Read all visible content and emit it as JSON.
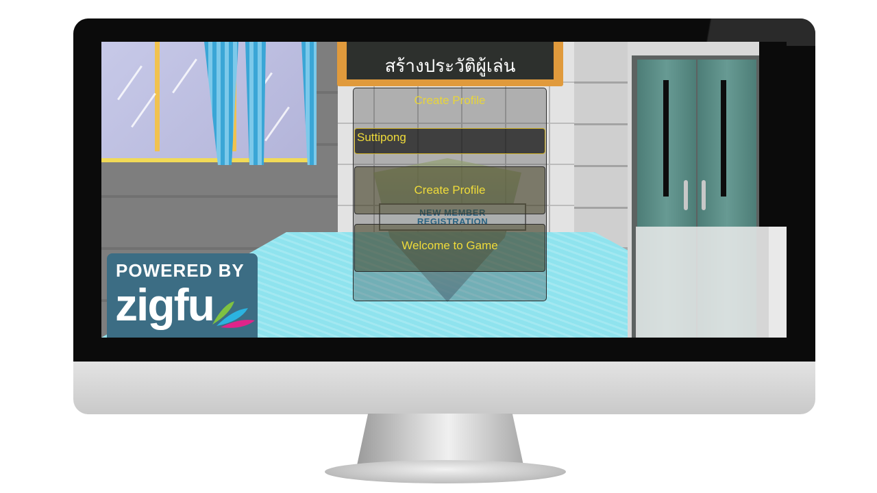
{
  "scene": {
    "chalkboard_title": "สร้างประวัติผู้เล่น",
    "emblem_lines": [
      "NEW MEMBER",
      "REGISTRATION"
    ]
  },
  "profile_panel": {
    "title": "Create Profile",
    "name_value": "Suttipong",
    "create_button_label": "Create Profile",
    "welcome_button_label": "Welcome to Game"
  },
  "badge": {
    "powered_by": "POWERED BY",
    "logo_text": "zigfu"
  },
  "colors": {
    "gui_text": "#f0dc3a",
    "floor": "#8fe3ee",
    "badge_bg": "#3c6d84"
  }
}
